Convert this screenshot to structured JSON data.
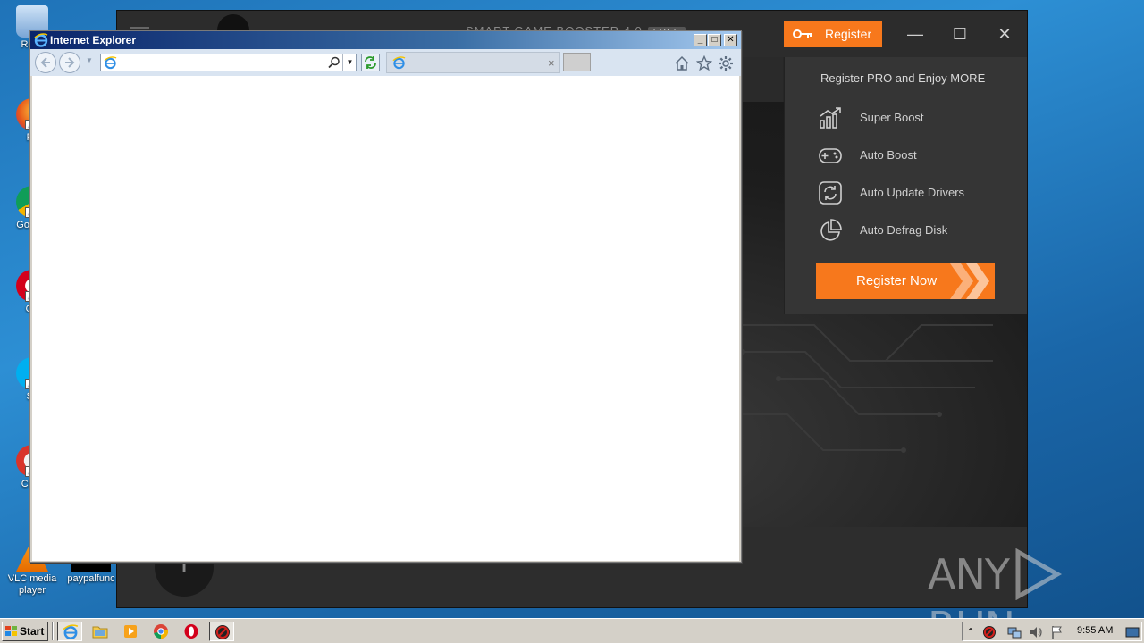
{
  "desktop": {
    "icons": [
      {
        "label": "Recy"
      },
      {
        "label": "Fir"
      },
      {
        "label": "Go Chr"
      },
      {
        "label": "Op"
      },
      {
        "label": "Sk"
      },
      {
        "label": "CCle"
      },
      {
        "label": "VLC media player"
      },
      {
        "label": "paypalfunc"
      }
    ]
  },
  "game_booster": {
    "title": "SMART GAME BOOSTER 4.0",
    "badge": "FREE",
    "register_label": "Register",
    "minimize": "—",
    "maximize": "☐",
    "close": "✕",
    "add_button": "+",
    "panel": {
      "title": "Register PRO and Enjoy MORE",
      "features": [
        {
          "label": "Super Boost",
          "icon": "chart-bars-icon"
        },
        {
          "label": "Auto Boost",
          "icon": "gamepad-icon"
        },
        {
          "label": "Auto Update Drivers",
          "icon": "refresh-icon"
        },
        {
          "label": "Auto Defrag Disk",
          "icon": "pie-icon"
        }
      ],
      "register_now_label": "Register Now"
    },
    "accent_color": "#f7781c"
  },
  "ie": {
    "title": "Internet Explorer",
    "address_value": "",
    "tab_title": "",
    "tab_close": "×",
    "ctrl_min": "_",
    "ctrl_max": "□",
    "ctrl_close": "✕"
  },
  "taskbar": {
    "start_label": "Start",
    "clock": "9:55 AM"
  },
  "watermark": {
    "left": "ANY",
    "right": "RUN"
  }
}
